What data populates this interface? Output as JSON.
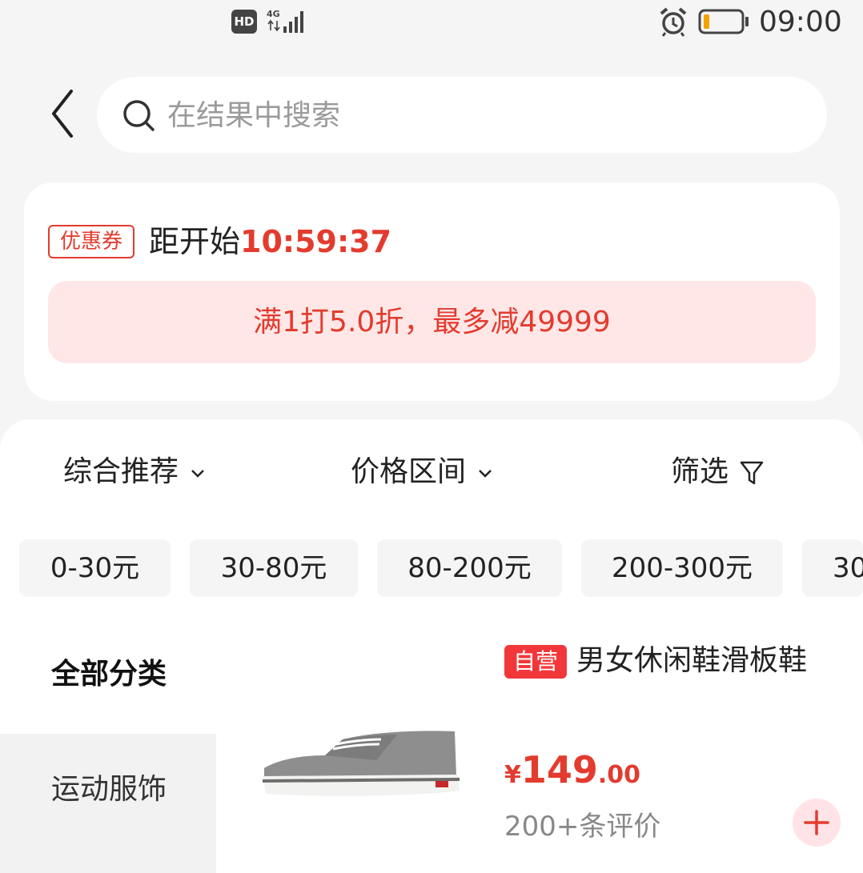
{
  "status_bar": {
    "hd_label": "HD",
    "network": "4G",
    "time": "09:00"
  },
  "search": {
    "placeholder": "在结果中搜索"
  },
  "coupon": {
    "tag": "优惠券",
    "start_label": "距开始",
    "countdown": "10:59:37",
    "rule": "满1打5.0折，最多减49999"
  },
  "sort_bar": {
    "comprehensive": "综合推荐",
    "price_range": "价格区间",
    "filter": "筛选"
  },
  "price_chips": [
    "0-30元",
    "30-80元",
    "80-200元",
    "200-300元",
    "30"
  ],
  "category": {
    "title": "全部分类",
    "items": [
      "运动服饰"
    ]
  },
  "product": {
    "badge": "自营",
    "title": "男女休闲鞋滑板鞋",
    "price_symbol": "¥",
    "price_integer": "149",
    "price_decimal": ".00",
    "reviews": "200+条评价"
  },
  "colors": {
    "accent": "#e33b2e",
    "badge": "#f2373a",
    "coupon_bg": "#ffe7e7",
    "page_bg": "#f5f5f5"
  }
}
